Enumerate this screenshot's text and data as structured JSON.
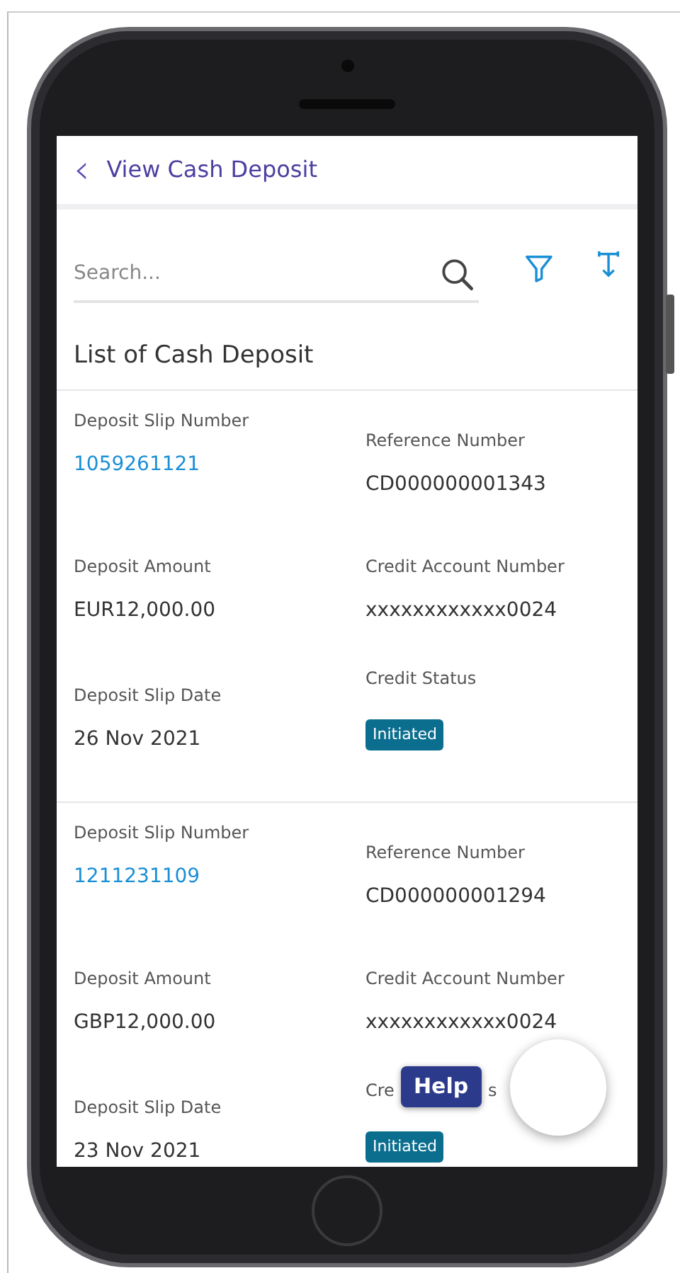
{
  "header": {
    "back_glyph": "‹",
    "title": "View Cash Deposit"
  },
  "search": {
    "placeholder": "Search..."
  },
  "list_title": "List of Cash Deposit",
  "cards": [
    {
      "left": [
        {
          "label": "Deposit Slip Number",
          "value": "1059261121",
          "kind": "link"
        },
        {
          "label": "Deposit Amount",
          "value": "EUR12,000.00",
          "kind": "text"
        },
        {
          "label": "Deposit Slip Date",
          "value": "26 Nov 2021",
          "kind": "text"
        }
      ],
      "right": [
        {
          "label": "Reference Number",
          "value": "CD000000001343",
          "kind": "text"
        },
        {
          "label": "Credit Account Number",
          "value": "xxxxxxxxxxxx0024",
          "kind": "text"
        },
        {
          "label": "Credit Status",
          "value": "Initiated",
          "kind": "badge"
        }
      ]
    },
    {
      "left": [
        {
          "label": "Deposit Slip Number",
          "value": "1211231109",
          "kind": "link"
        },
        {
          "label": "Deposit Amount",
          "value": "GBP12,000.00",
          "kind": "text"
        },
        {
          "label": "Deposit Slip Date",
          "value": "23 Nov 2021",
          "kind": "text"
        }
      ],
      "right": [
        {
          "label": "Reference Number",
          "value": "CD000000001294",
          "kind": "text"
        },
        {
          "label": "Credit Account Number",
          "value": "xxxxxxxxxxxx0024",
          "kind": "text"
        },
        {
          "label": "Cre",
          "label_end": "s",
          "value": "Initiated",
          "kind": "badge"
        }
      ]
    }
  ],
  "help_button": "Help"
}
